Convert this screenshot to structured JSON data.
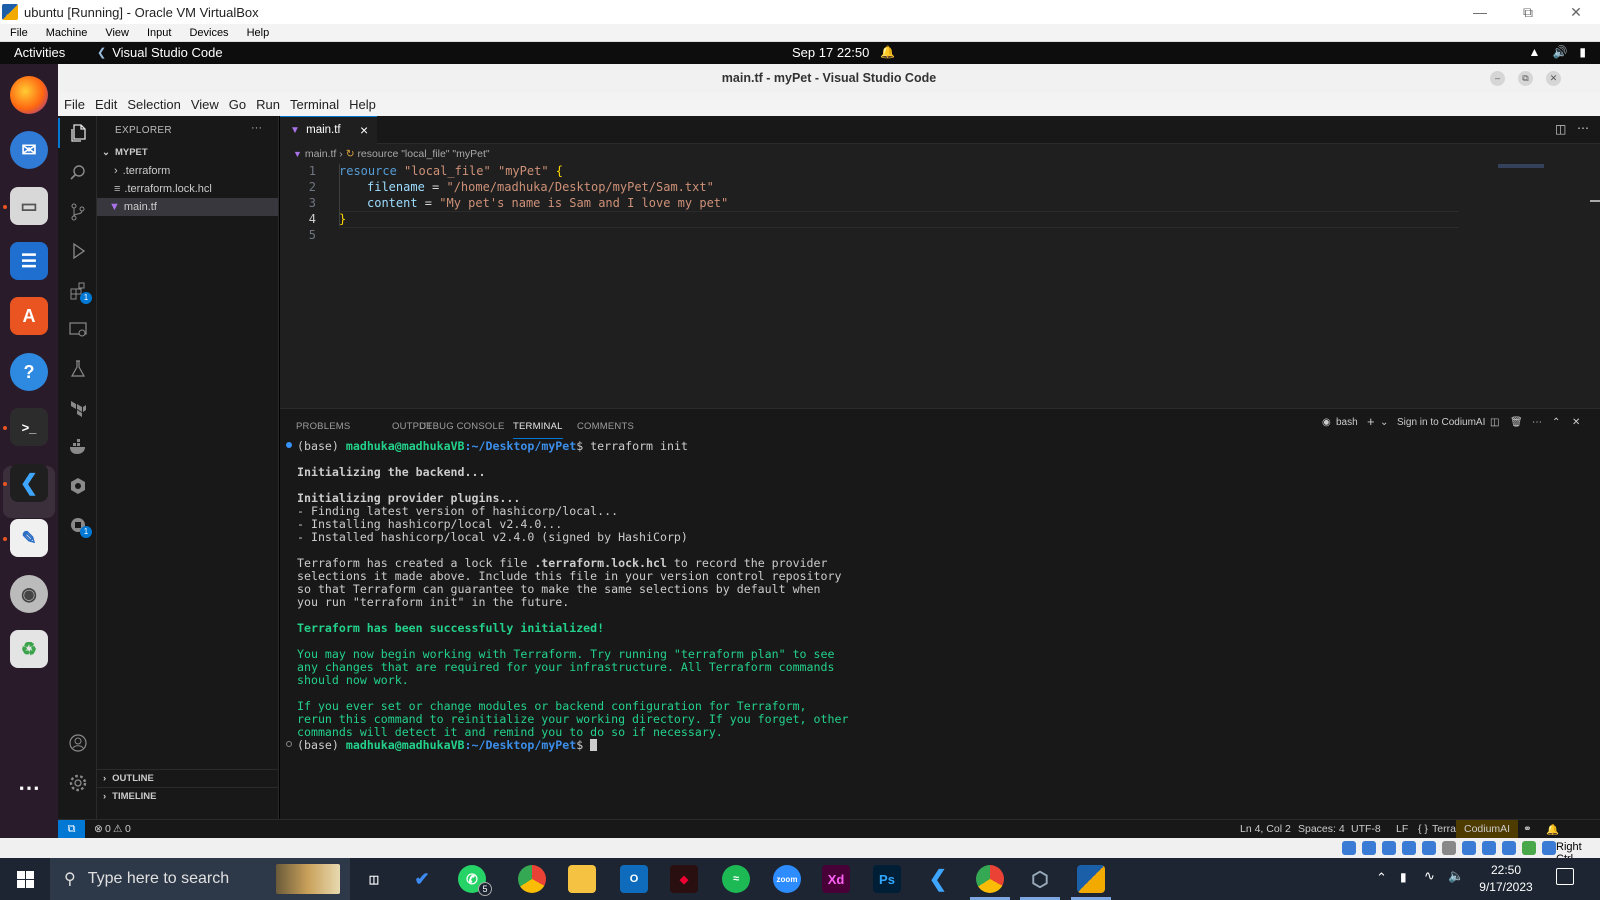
{
  "vbox": {
    "title": "ubuntu [Running] - Oracle VM VirtualBox",
    "menu": [
      "File",
      "Machine",
      "View",
      "Input",
      "Devices",
      "Help"
    ],
    "status_right": "Right Ctrl"
  },
  "gnome": {
    "activities": "Activities",
    "app_name": "Visual Studio Code",
    "clock": "Sep 17  22:50"
  },
  "vscode": {
    "window_title": "main.tf - myPet - Visual Studio Code",
    "menu": [
      "File",
      "Edit",
      "Selection",
      "View",
      "Go",
      "Run",
      "Terminal",
      "Help"
    ],
    "activity_badges": {
      "extensions": "1",
      "remote": "1"
    },
    "explorer": {
      "title": "EXPLORER",
      "more": "···",
      "folder": "MYPET",
      "items": [
        ".terraform",
        ".terraform.lock.hcl",
        "main.tf"
      ],
      "sections": [
        "OUTLINE",
        "TIMELINE"
      ]
    },
    "tab": {
      "label": "main.tf",
      "close": "×"
    },
    "breadcrumb": {
      "file": "main.tf",
      "symbol": "resource \"local_file\" \"myPet\""
    },
    "editor": {
      "line_numbers": [
        "1",
        "2",
        "3",
        "4",
        "5"
      ],
      "line1": {
        "keyword": "resource",
        "type": "\"local_file\"",
        "name": "\"myPet\"",
        "brace": "{"
      },
      "line2": {
        "key": "filename",
        "eq": " = ",
        "value": "\"/home/madhuka/Desktop/myPet/Sam.txt\""
      },
      "line3": {
        "key": "content",
        "eq": " = ",
        "value": "\"My pet's name is Sam and I love my pet\""
      },
      "line4": "}"
    },
    "panel": {
      "tabs": [
        "PROBLEMS",
        "OUTPUT",
        "DEBUG CONSOLE",
        "TERMINAL",
        "COMMENTS"
      ],
      "active_tab": "TERMINAL",
      "shell": "bash",
      "codium_link": "Sign in to CodiumAI"
    },
    "terminal": {
      "prompt_env": "(base) ",
      "prompt_user": "madhuka@madhukaVB",
      "prompt_path": ":~/Desktop/myPet",
      "prompt_symbol": "$ ",
      "command": "terraform init",
      "backend": "Initializing the backend...",
      "plugins": "Initializing provider plugins...",
      "plugin_lines": [
        "- Finding latest version of hashicorp/local...",
        "- Installing hashicorp/local v2.4.0...",
        "- Installed hashicorp/local v2.4.0 (signed by HashiCorp)"
      ],
      "lock_pre": "Terraform has created a lock file ",
      "lock_file": ".terraform.lock.hcl",
      "lock_post": " to record the provider",
      "lock_lines": [
        "selections it made above. Include this file in your version control repository",
        "so that Terraform can guarantee to make the same selections by default when",
        "you run \"terraform init\" in the future."
      ],
      "success": "Terraform has been successfully initialized!",
      "info_lines": [
        "You may now begin working with Terraform. Try running \"terraform plan\" to see",
        "any changes that are required for your infrastructure. All Terraform commands",
        "should now work."
      ],
      "rerun_lines": [
        "If you ever set or change modules or backend configuration for Terraform,",
        "rerun this command to reinitialize your working directory. If you forget, other",
        "commands will detect it and remind you to do so if necessary."
      ]
    },
    "status": {
      "problems": "0",
      "warnings": "0",
      "position": "Ln 4, Col 2",
      "spaces": "Spaces: 4",
      "encoding": "UTF-8",
      "eol": "LF",
      "language": "Terraform",
      "codium": "CodiumAI"
    }
  },
  "taskbar": {
    "search_placeholder": "Type here to search",
    "whatsapp_badge": "5",
    "zoom_label": "zoom",
    "xd_label": "Xd",
    "ps_label": "Ps",
    "time": "22:50",
    "date": "9/17/2023"
  },
  "colors": {
    "accent": "#0078d4",
    "terminal_green": "#23d18b",
    "codium_bg": "#4d3b00",
    "ubuntu_orange": "#e95420"
  }
}
